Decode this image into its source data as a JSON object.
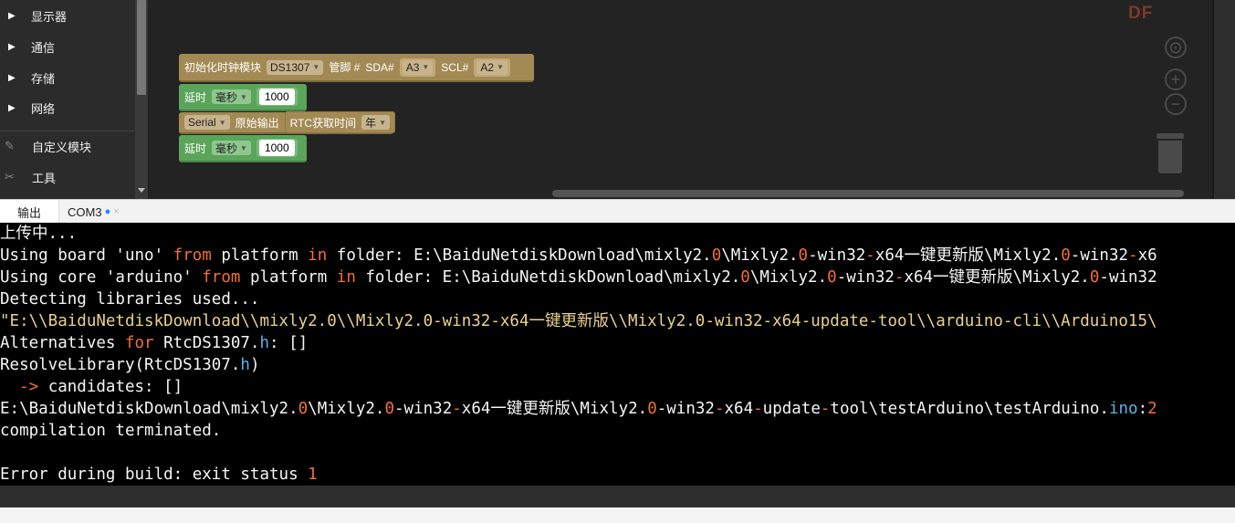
{
  "sidebar": {
    "items": [
      {
        "label": "显示器",
        "icon": "triangle-right"
      },
      {
        "label": "通信",
        "icon": "triangle-right"
      },
      {
        "label": "存储",
        "icon": "triangle-right"
      },
      {
        "label": "网络",
        "icon": "triangle-right"
      },
      {
        "label": "自定义模块",
        "icon": "pen-icon"
      },
      {
        "label": "工具",
        "icon": "tools-icon"
      }
    ]
  },
  "workspace": {
    "logo": "DF",
    "blocks": {
      "init": {
        "label": "初始化时钟模块",
        "model": "DS1307",
        "pin_label": "管脚 #",
        "sda_label": "SDA#",
        "sda_value": "A3",
        "scl_label": "SCL#",
        "scl_value": "A2"
      },
      "delay1": {
        "label": "延时",
        "unit": "毫秒",
        "value": "1000"
      },
      "print": {
        "serial": "Serial",
        "label": "原始输出",
        "rtc_label": "RTC获取时间",
        "field": "年"
      },
      "delay2": {
        "label": "延时",
        "unit": "毫秒",
        "value": "1000"
      }
    },
    "controls": [
      "recenter-icon",
      "zoom-in-icon",
      "zoom-out-icon",
      "trash-icon"
    ]
  },
  "tabs": {
    "output": "输出",
    "com": "COM3",
    "com_dot": "●",
    "com_close": "×"
  },
  "console": {
    "lines": [
      "上传中...",
      "Using board 'uno' from platform in folder: E:\\BaiduNetdiskDownload\\mixly2.0\\Mixly2.0-win32-x64一键更新版\\Mixly2.0-win32-x6",
      "Using core 'arduino' from platform in folder: E:\\BaiduNetdiskDownload\\mixly2.0\\Mixly2.0-win32-x64一键更新版\\Mixly2.0-win32",
      "Detecting libraries used...",
      "\"E:\\\\BaiduNetdiskDownload\\\\mixly2.0\\\\Mixly2.0-win32-x64一键更新版\\\\Mixly2.0-win32-x64-update-tool\\\\arduino-cli\\\\Arduino15\\",
      "Alternatives for RtcDS1307.h: []",
      "ResolveLibrary(RtcDS1307.h)",
      "  -> candidates: []",
      "E:\\BaiduNetdiskDownload\\mixly2.0\\Mixly2.0-win32-x64一键更新版\\Mixly2.0-win32-x64-update-tool\\testArduino\\testArduino.ino:2",
      "compilation terminated.",
      "",
      "Error during build: exit status 1"
    ]
  }
}
